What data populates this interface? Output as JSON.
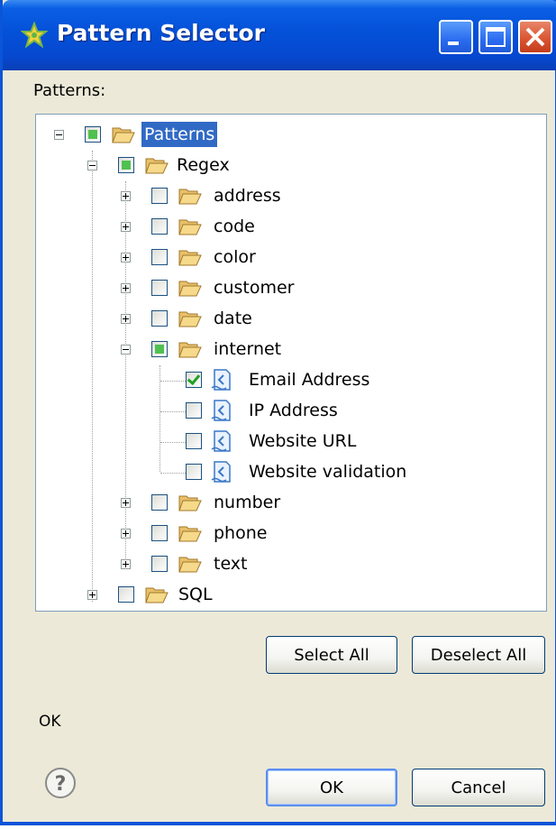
{
  "window": {
    "title": "Pattern Selector"
  },
  "title_icons": [
    "app-star-icon",
    "minimize-icon",
    "maximize-icon",
    "close-icon"
  ],
  "labels": {
    "patterns": "Patterns:"
  },
  "tree": {
    "root": {
      "label": "Patterns",
      "state": "partial",
      "expanded": true,
      "selected": true
    },
    "regex": {
      "label": "Regex",
      "state": "partial",
      "expanded": true
    },
    "regex_folders": [
      {
        "label": "address",
        "state": "unchecked",
        "expanded": false
      },
      {
        "label": "code",
        "state": "unchecked",
        "expanded": false
      },
      {
        "label": "color",
        "state": "unchecked",
        "expanded": false
      },
      {
        "label": "customer",
        "state": "unchecked",
        "expanded": false
      },
      {
        "label": "date",
        "state": "unchecked",
        "expanded": false
      },
      {
        "label": "internet",
        "state": "partial",
        "expanded": true
      }
    ],
    "internet_items": [
      {
        "label": "Email Address",
        "state": "checked"
      },
      {
        "label": "IP Address",
        "state": "unchecked"
      },
      {
        "label": "Website URL",
        "state": "unchecked"
      },
      {
        "label": "Website validation",
        "state": "unchecked"
      }
    ],
    "regex_folders_after": [
      {
        "label": "number",
        "state": "unchecked",
        "expanded": false
      },
      {
        "label": "phone",
        "state": "unchecked",
        "expanded": false
      },
      {
        "label": "text",
        "state": "unchecked",
        "expanded": false
      }
    ],
    "sql": {
      "label": "SQL",
      "state": "unchecked",
      "expanded": false
    }
  },
  "buttons": {
    "select_all": "Select All",
    "deselect_all": "Deselect All",
    "ok": "OK",
    "cancel": "Cancel"
  },
  "status": {
    "text": "OK"
  },
  "colors": {
    "titlebar": "#0451d8",
    "selection": "#316ac5",
    "partial_fill": "#4fc14f",
    "check": "#21a121",
    "dialog_bg": "#ece9d8"
  }
}
